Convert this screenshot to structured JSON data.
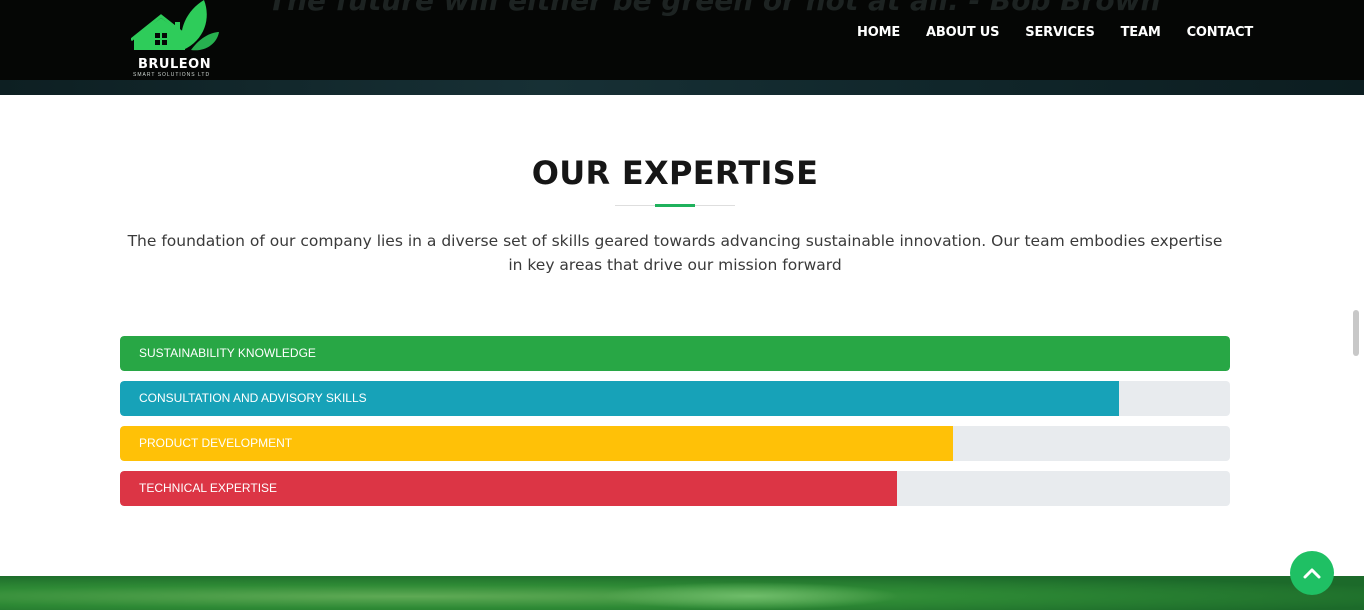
{
  "header": {
    "quote": "The future will either be green or not at all. - Bob Brown",
    "logo": {
      "name": "BRULEON",
      "subtitle": "SMART SOLUTIONS LTD"
    },
    "nav": [
      {
        "label": "HOME"
      },
      {
        "label": "ABOUT US"
      },
      {
        "label": "SERVICES"
      },
      {
        "label": "TEAM"
      },
      {
        "label": "CONTACT"
      }
    ]
  },
  "expertise": {
    "title": "OUR EXPERTISE",
    "intro": "The foundation of our company lies in a diverse set of skills geared towards advancing sustainable innovation. Our team embodies expertise in key areas that drive our mission forward",
    "skills": [
      {
        "label": "SUSTAINABILITY KNOWLEDGE",
        "percent": 100,
        "color": "#28a745"
      },
      {
        "label": "CONSULTATION AND ADVISORY SKILLS",
        "percent": 90,
        "color": "#17a2b8"
      },
      {
        "label": "PRODUCT DEVELOPMENT",
        "percent": 75,
        "color": "#ffc107"
      },
      {
        "label": "TECHNICAL EXPERTISE",
        "percent": 70,
        "color": "#dc3545"
      }
    ]
  },
  "scroll_top": {
    "icon": "chevron-up-icon",
    "color": "#1fc064"
  },
  "colors": {
    "accent": "#1fb15c",
    "logo_green": "#2ecc5a"
  }
}
